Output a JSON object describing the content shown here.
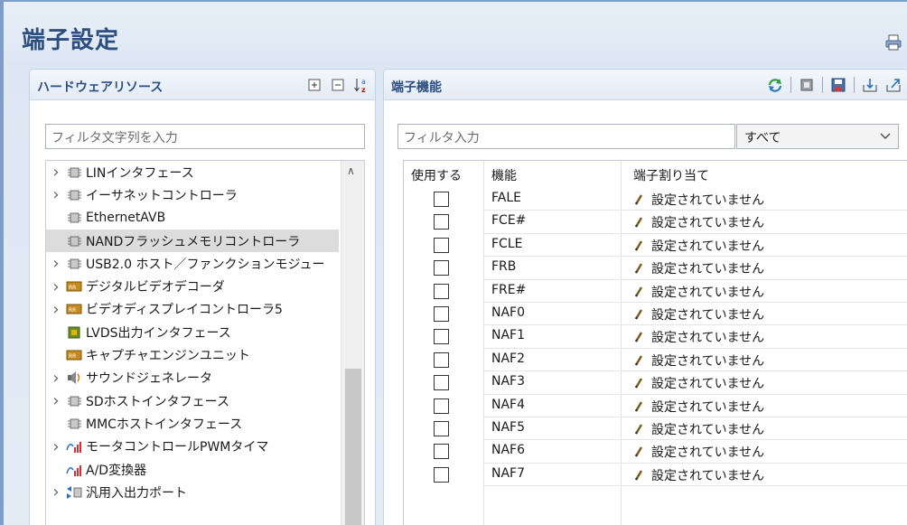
{
  "page": {
    "title": "端子設定"
  },
  "left_panel": {
    "title": "ハードウェアリソース",
    "filter_placeholder": "フィルタ文字列を入力",
    "tree": [
      {
        "label": "LINインタフェース",
        "expandable": true,
        "icon": "chip-icon",
        "selected": false
      },
      {
        "label": "イーサネットコントローラ",
        "expandable": true,
        "icon": "chip-icon",
        "selected": false
      },
      {
        "label": "EthernetAVB",
        "expandable": false,
        "icon": "chip-icon",
        "selected": false
      },
      {
        "label": "NANDフラッシュメモリコントローラ",
        "expandable": false,
        "icon": "chip-icon",
        "selected": true
      },
      {
        "label": "USB2.0 ホスト／ファンクションモジュー",
        "expandable": true,
        "icon": "chip-icon",
        "selected": false
      },
      {
        "label": "デジタルビデオデコーダ",
        "expandable": true,
        "icon": "video-icon",
        "selected": false
      },
      {
        "label": "ビデオディスプレイコントローラ5",
        "expandable": true,
        "icon": "video-icon",
        "selected": false
      },
      {
        "label": "LVDS出力インタフェース",
        "expandable": false,
        "icon": "lvds-icon",
        "selected": false
      },
      {
        "label": "キャプチャエンジンユニット",
        "expandable": false,
        "icon": "video-icon",
        "selected": false
      },
      {
        "label": "サウンドジェネレータ",
        "expandable": true,
        "icon": "sound-icon",
        "selected": false
      },
      {
        "label": "SDホストインタフェース",
        "expandable": true,
        "icon": "chip-icon",
        "selected": false
      },
      {
        "label": "MMCホストインタフェース",
        "expandable": false,
        "icon": "chip-icon",
        "selected": false
      },
      {
        "label": "モータコントロールPWMタイマ",
        "expandable": true,
        "icon": "pwm-icon",
        "selected": false
      },
      {
        "label": "A/D変換器",
        "expandable": false,
        "icon": "pwm-icon",
        "selected": false
      },
      {
        "label": "汎用入出力ポート",
        "expandable": true,
        "icon": "gpio-icon",
        "selected": false
      }
    ]
  },
  "right_panel": {
    "title": "端子機能",
    "filter_placeholder": "フィルタ入力",
    "select_value": "すべて",
    "columns": {
      "use": "使用する",
      "function": "機能",
      "assign": "端子割り当て"
    },
    "rows": [
      {
        "function": "FALE",
        "assign": "設定されていません",
        "checked": false
      },
      {
        "function": "FCE#",
        "assign": "設定されていません",
        "checked": false
      },
      {
        "function": "FCLE",
        "assign": "設定されていません",
        "checked": false
      },
      {
        "function": "FRB",
        "assign": "設定されていません",
        "checked": false
      },
      {
        "function": "FRE#",
        "assign": "設定されていません",
        "checked": false
      },
      {
        "function": "NAF0",
        "assign": "設定されていません",
        "checked": false
      },
      {
        "function": "NAF1",
        "assign": "設定されていません",
        "checked": false
      },
      {
        "function": "NAF2",
        "assign": "設定されていません",
        "checked": false
      },
      {
        "function": "NAF3",
        "assign": "設定されていません",
        "checked": false
      },
      {
        "function": "NAF4",
        "assign": "設定されていません",
        "checked": false
      },
      {
        "function": "NAF5",
        "assign": "設定されていません",
        "checked": false
      },
      {
        "function": "NAF6",
        "assign": "設定されていません",
        "checked": false
      },
      {
        "function": "NAF7",
        "assign": "設定されていません",
        "checked": false
      }
    ]
  },
  "colors": {
    "title_blue": "#2d4f80",
    "frame_border": "#7f9ec7",
    "selection": "#dcdcdc"
  }
}
